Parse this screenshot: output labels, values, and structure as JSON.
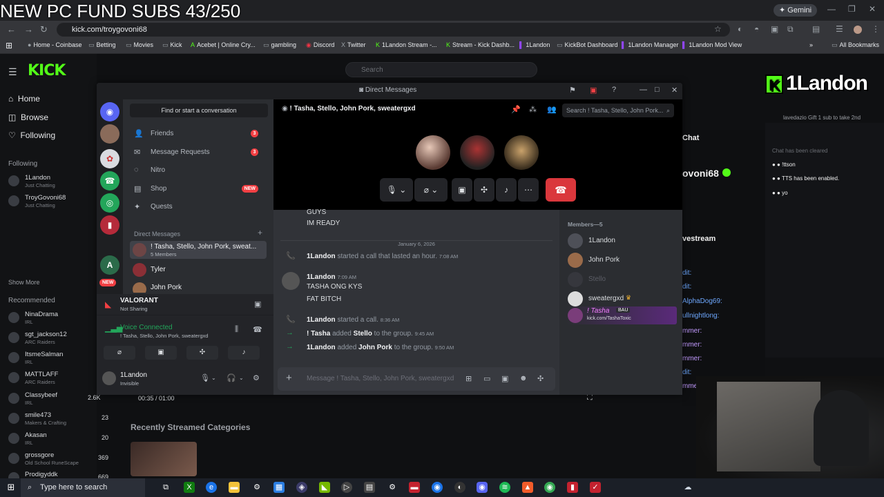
{
  "overlay_text": "NEW PC FUND SUBS 43/250",
  "browser": {
    "gemini_label": "Gemini",
    "url": "kick.com/troygovoni68",
    "bookmarks": [
      {
        "label": "Home - Coinbase",
        "icon": "coinbase-icon"
      },
      {
        "label": "Betting",
        "icon": "folder-icon"
      },
      {
        "label": "Movies",
        "icon": "folder-icon"
      },
      {
        "label": "Kick",
        "icon": "folder-icon"
      },
      {
        "label": "Acebet | Online Cry...",
        "icon": "acebet-icon"
      },
      {
        "label": "gambling",
        "icon": "folder-icon"
      },
      {
        "label": "Discord",
        "icon": "discord-icon"
      },
      {
        "label": "Twitter",
        "icon": "x-icon"
      },
      {
        "label": "1Landon Stream -...",
        "icon": "kick-icon"
      },
      {
        "label": "Stream - Kick Dashb...",
        "icon": "kick-icon"
      },
      {
        "label": "1Landon",
        "icon": "twitch-icon"
      },
      {
        "label": "KickBot Dashboard",
        "icon": "folder-icon"
      },
      {
        "label": "1Landon Manager",
        "icon": "twitch-icon"
      },
      {
        "label": "1Landon Mod View",
        "icon": "twitch-icon"
      }
    ],
    "all_bookmarks": "All Bookmarks"
  },
  "kick": {
    "logo": "KICK",
    "search_placeholder": "Search",
    "nav": {
      "home": "Home",
      "browse": "Browse",
      "following": "Following"
    },
    "following_header": "Following",
    "following": [
      {
        "name": "1Landon",
        "game": "Just Chatting"
      },
      {
        "name": "TroyGovoni68",
        "game": "Just Chatting"
      }
    ],
    "show_more": "Show More",
    "recommended_header": "Recommended",
    "recommended": [
      {
        "name": "NinaDrama",
        "game": "IRL",
        "viewers": ""
      },
      {
        "name": "sgt_jackson12",
        "game": "ARC Raiders",
        "viewers": ""
      },
      {
        "name": "ItsmeSalman",
        "game": "IRL",
        "viewers": ""
      },
      {
        "name": "MATTLAFF",
        "game": "ARC Raiders",
        "viewers": ""
      },
      {
        "name": "Classybeef",
        "game": "IRL",
        "viewers": "2.6K"
      },
      {
        "name": "smile473",
        "game": "Makers & Crafting",
        "viewers": "23"
      },
      {
        "name": "Akasan",
        "game": "IRL",
        "viewers": "20"
      },
      {
        "name": "grossgore",
        "game": "Old School RuneScape",
        "viewers": "369"
      },
      {
        "name": "Prodigyddk",
        "game": "",
        "viewers": "669"
      }
    ],
    "recently_streamed": "Recently Streamed Categories",
    "player_time": "00:35 / 01:00",
    "chat_title": "Chat",
    "channel_name": "ovoni68",
    "livestream_label": "vestream",
    "chat_cleared": "Chat has been cleared",
    "chat_lines": [
      {
        "user": "",
        "text": "!ttson"
      },
      {
        "user": "",
        "text": "TTS has been enabled."
      },
      {
        "user": "",
        "text": "yo"
      }
    ],
    "chat_left_lines": [
      "dit:",
      "dit:",
      "AlphaDog69:",
      "ullnightlong:",
      "mmer:",
      "mmer:",
      "mmer:",
      "dit:",
      "mme"
    ],
    "gift_text": "Gift 1 sub to take 2nd",
    "gift_user": "lavedazio",
    "stream_logo": "1Landon"
  },
  "discord": {
    "window_title": "Direct Messages",
    "find_conversation": "Find or start a conversation",
    "nav": [
      {
        "label": "Friends",
        "icon": "friends-icon",
        "badge": "3"
      },
      {
        "label": "Message Requests",
        "icon": "mail-icon",
        "badge": "3"
      },
      {
        "label": "Nitro",
        "icon": "nitro-icon",
        "badge": ""
      },
      {
        "label": "Shop",
        "icon": "shop-icon",
        "badge": "NEW"
      },
      {
        "label": "Quests",
        "icon": "quests-icon",
        "badge": ""
      }
    ],
    "dm_header": "Direct Messages",
    "dms": [
      {
        "name": "! Tasha, Stello, John Pork, sweat...",
        "sub": "5 Members"
      },
      {
        "name": "Tyler",
        "sub": ""
      },
      {
        "name": "John Pork",
        "sub": ""
      }
    ],
    "guild_new_badge": "NEW",
    "activity": {
      "name": "VALORANT",
      "status": "Not Sharing"
    },
    "voice": {
      "status": "Voice Connected",
      "channel": "! Tasha, Stello, John Pork, sweatergxd"
    },
    "user": {
      "name": "1Landon",
      "status": "Invisible"
    },
    "call_header": "! Tasha, Stello, John Pork, sweatergxd",
    "search_placeholder": "Search ! Tasha, Stello, John Pork...",
    "messages_top": [
      "GUYS",
      "IM READY"
    ],
    "date_divider": "January 6, 2026",
    "events": [
      {
        "user": "1Landon",
        "text": "started a call that lasted an hour.",
        "time": "7:08 AM"
      },
      {
        "user": "1Landon",
        "time": "7:09 AM",
        "lines": [
          "TASHA ONG KYS",
          "FAT BITCH"
        ]
      },
      {
        "user": "1Landon",
        "text": "started a call.",
        "time": "8:36 AM"
      },
      {
        "user": "! Tasha",
        "text": "added",
        "target": "Stello",
        "suffix": "to the group.",
        "time": "9:45 AM"
      },
      {
        "user": "1Landon",
        "text": "added",
        "target": "John Pork",
        "suffix": "to the group.",
        "time": "9:50 AM"
      }
    ],
    "message_placeholder": "Message ! Tasha, Stello, John Pork, sweatergxd",
    "members_header": "Members—5",
    "members": [
      "1Landon",
      "John Pork",
      "Stello",
      "sweatergxd"
    ],
    "tasha": {
      "name": "! Tasha",
      "tag": "BAU",
      "status": "kick.com/TashaToxic"
    }
  },
  "taskbar": {
    "search_placeholder": "Type here to search"
  }
}
